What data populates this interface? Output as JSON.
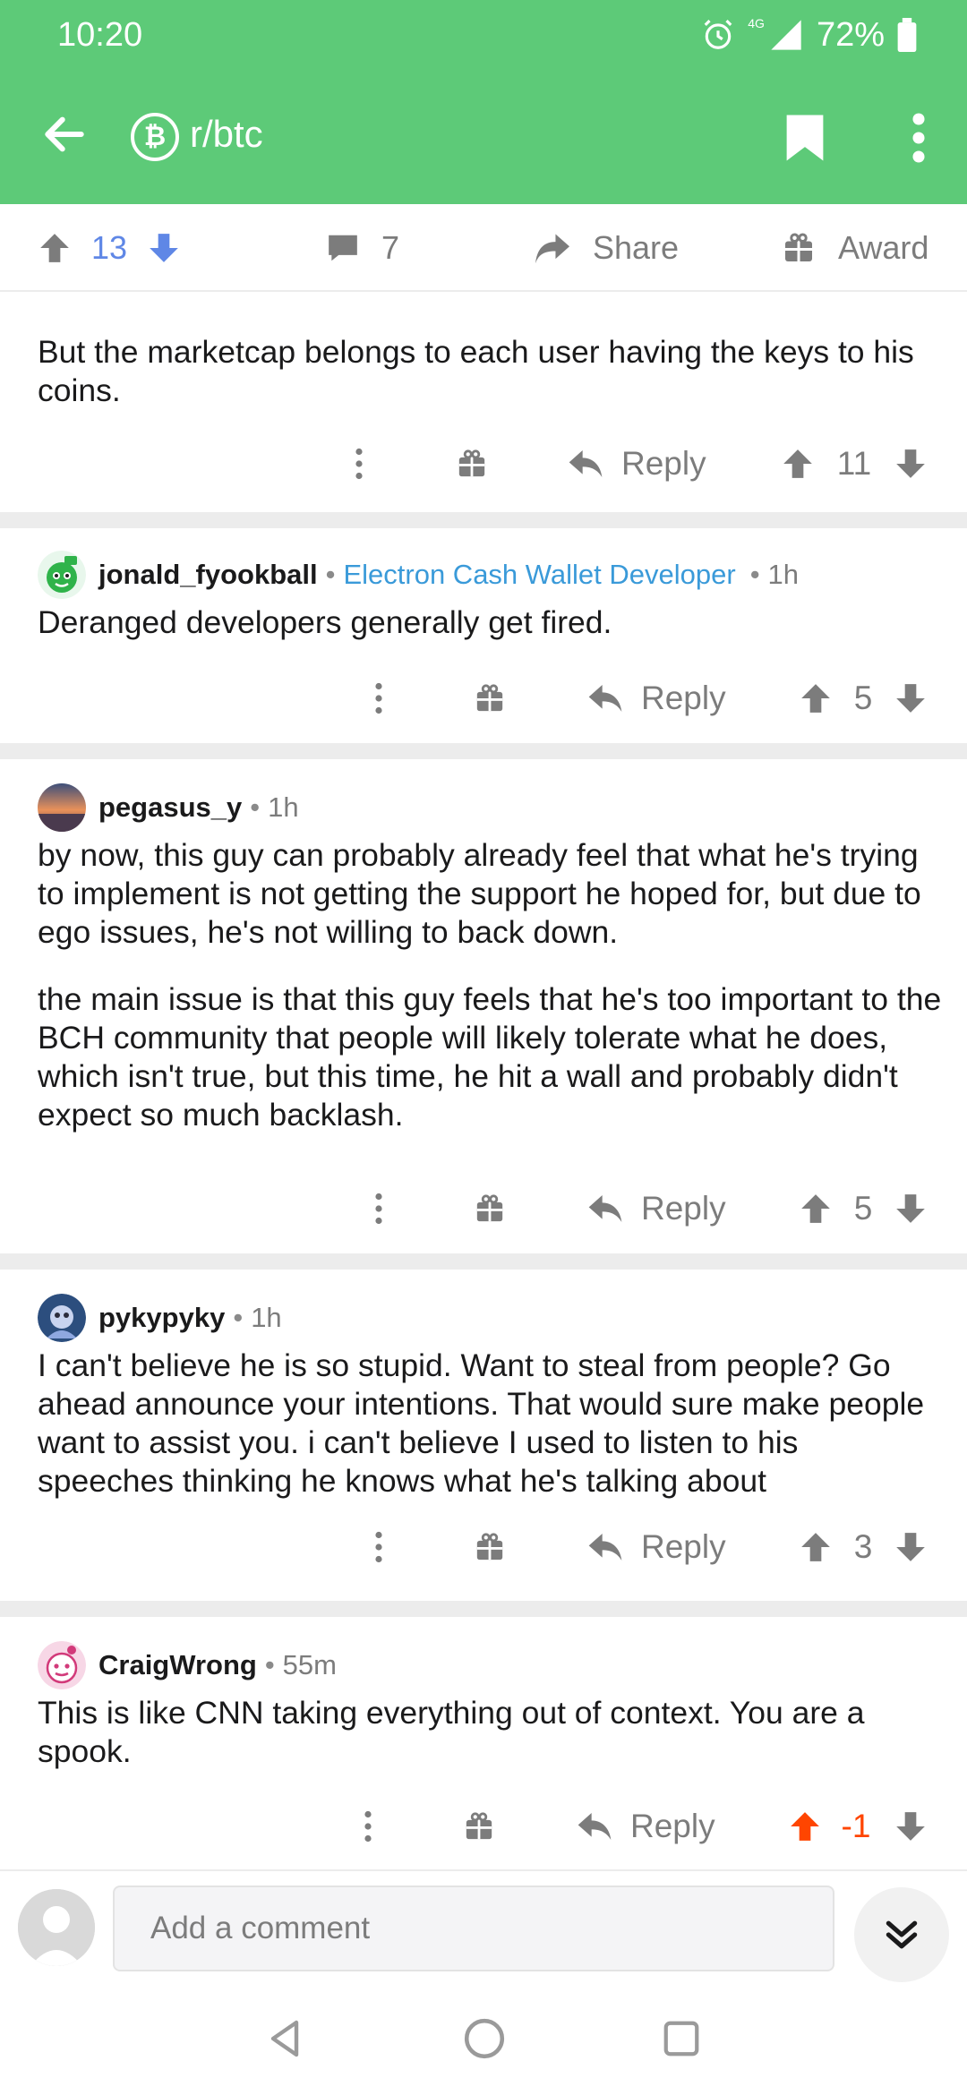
{
  "status_bar": {
    "time": "10:20",
    "network": "4G",
    "battery": "72%"
  },
  "header": {
    "subreddit": "r/btc",
    "sub_icon": "bitcoin-icon",
    "bg_color": "#5dca78"
  },
  "post_bar": {
    "score": "13",
    "comment_count": "7",
    "share_label": "Share",
    "award_label": "Award"
  },
  "comments": [
    {
      "body": [
        "But the marketcap belongs to each user having the keys to his coins."
      ],
      "reply_label": "Reply",
      "score": "11"
    },
    {
      "author": "jonald_fyookball",
      "flair": "Electron Cash Wallet Developer",
      "age": "1h",
      "body": [
        "Deranged developers generally get fired."
      ],
      "reply_label": "Reply",
      "score": "5"
    },
    {
      "author": "pegasus_y",
      "age": "1h",
      "body": [
        "by now, this guy can probably already feel that what he's trying to implement is not getting the support he hoped for, but due to ego issues, he's not willing to back down.",
        "the main issue is that this guy feels that he's too important to the BCH community that people will likely tolerate what he does, which isn't true, but this time, he hit a wall and probably didn't expect so much backlash."
      ],
      "reply_label": "Reply",
      "score": "5"
    },
    {
      "author": "pykypyky",
      "age": "1h",
      "body": [
        "I can't believe he is so stupid. Want to steal from people? Go ahead announce your intentions. That would sure make people want to assist you. i can't believe I used to listen to his speeches thinking he knows what he's talking about"
      ],
      "reply_label": "Reply",
      "score": "3"
    },
    {
      "author": "CraigWrong",
      "age": "55m",
      "body": [
        "This is like CNN taking everything out of context. You are a spook."
      ],
      "reply_label": "Reply",
      "score": "-1",
      "upvoted": true
    }
  ],
  "composer": {
    "placeholder": "Add a comment"
  },
  "colors": {
    "accent_green": "#5dca78",
    "flair_blue": "#3a9ad9",
    "upvote_orange": "#ff4500",
    "score_blue": "#5f87e6"
  }
}
